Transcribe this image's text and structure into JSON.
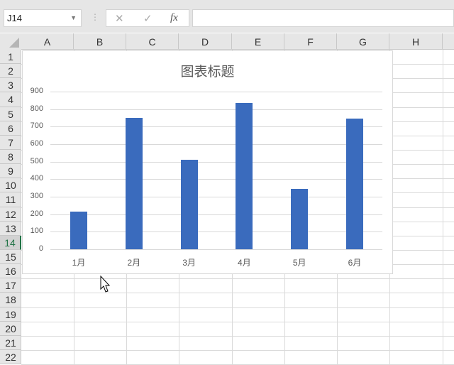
{
  "name_box": "J14",
  "formula_bar": {
    "cancel": "✕",
    "enter": "✓",
    "fx": "fx",
    "value": ""
  },
  "columns": [
    "A",
    "B",
    "C",
    "D",
    "E",
    "F",
    "G",
    "H"
  ],
  "rows": [
    "1",
    "2",
    "3",
    "4",
    "5",
    "6",
    "7",
    "8",
    "9",
    "10",
    "11",
    "12",
    "13",
    "14",
    "15",
    "16",
    "17",
    "18",
    "19",
    "20",
    "21",
    "22"
  ],
  "selected_row": "14",
  "colors": {
    "bar": "#3a6bbd",
    "accent": "#217346"
  },
  "chart_data": {
    "type": "bar",
    "title": "图表标题",
    "categories": [
      "1月",
      "2月",
      "3月",
      "4月",
      "5月",
      "6月"
    ],
    "values": [
      215,
      750,
      510,
      835,
      345,
      745
    ],
    "yticks": [
      "0",
      "100",
      "200",
      "300",
      "400",
      "500",
      "600",
      "700",
      "800",
      "900"
    ],
    "ylim": [
      0,
      900
    ],
    "grid": true,
    "xlabel": "",
    "ylabel": ""
  }
}
